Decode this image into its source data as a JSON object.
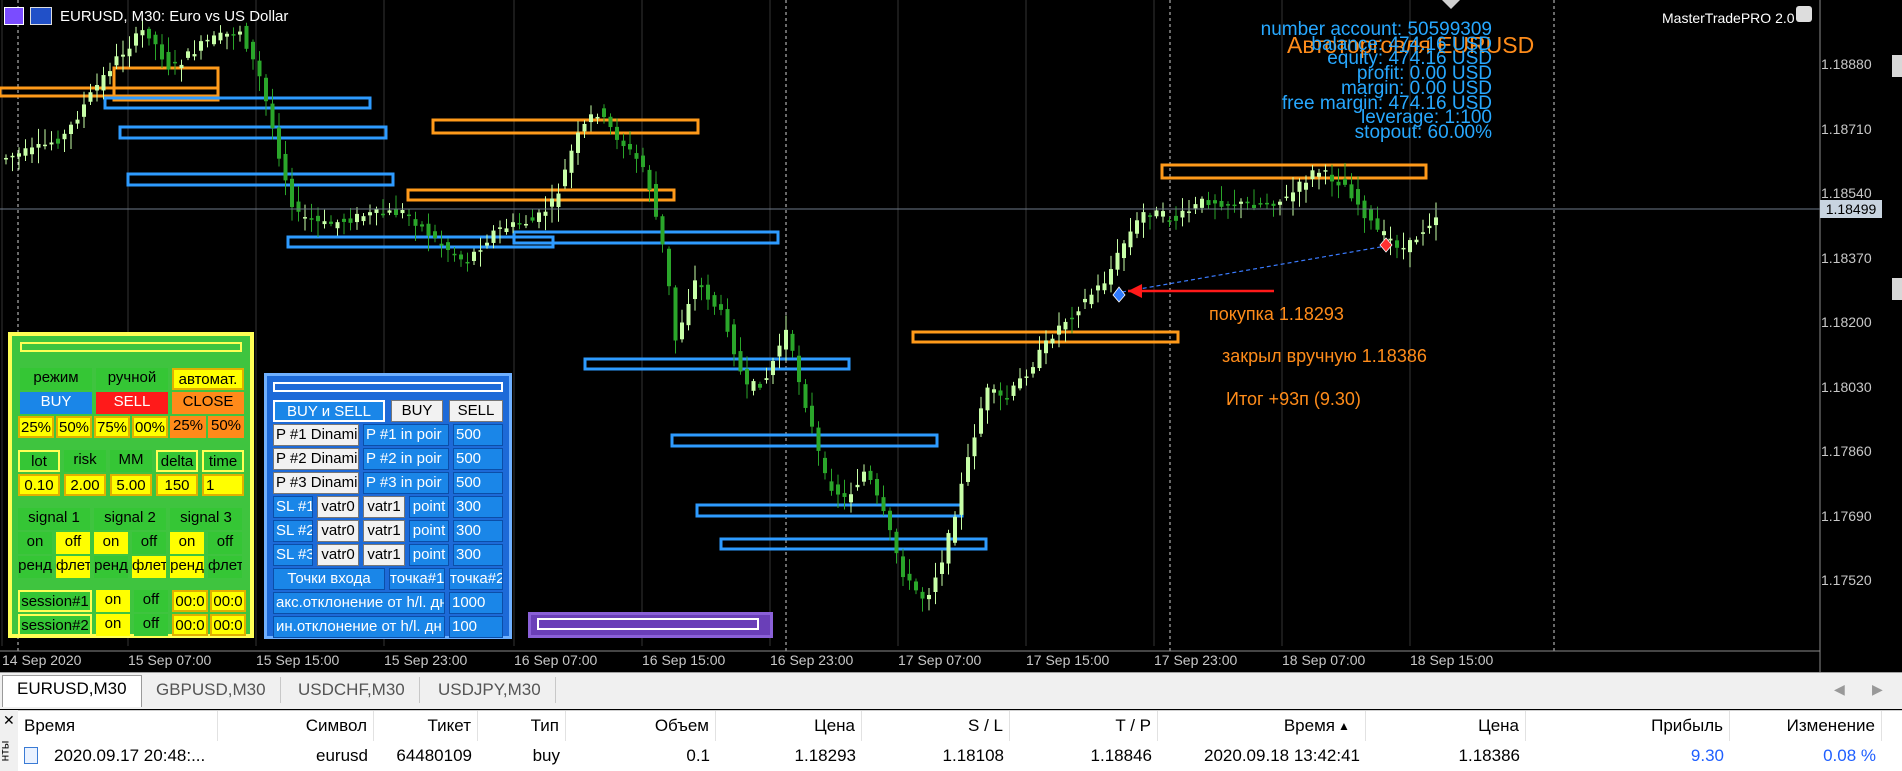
{
  "window": {
    "title": "EURUSD, M30:  Euro vs US Dollar",
    "badge": "MasterTradePRO 2.0"
  },
  "chart_title": "Автоторговля EURUSD",
  "account": [
    "number account: 50599309",
    "balance: 474.16 USD",
    "equity: 474.16 USD",
    "profit: 0.00 USD",
    "margin: 0.00 USD",
    "free margin: 474.16 USD",
    "leverage: 1:100",
    "stopout: 60.00%"
  ],
  "price_axis": [
    "1.18880",
    "1.18710",
    "1.18540",
    "1.18370",
    "1.18200",
    "1.18030",
    "1.17860",
    "1.17690",
    "1.17520"
  ],
  "current_price": "1.18499",
  "time_axis": [
    "14 Sep 2020",
    "15 Sep 07:00",
    "15 Sep 15:00",
    "15 Sep 23:00",
    "16 Sep 07:00",
    "16 Sep 15:00",
    "16 Sep 23:00",
    "17 Sep 07:00",
    "17 Sep 15:00",
    "17 Sep 23:00",
    "18 Sep 07:00",
    "18 Sep 15:00"
  ],
  "annotations": {
    "buy": "покупка 1.18293",
    "closed": "закрыл вручную 1.18386",
    "result": "Итог +93п (9.30)"
  },
  "panel_green": {
    "row1": [
      "режим",
      "ручной",
      "автомат."
    ],
    "row2": [
      "BUY",
      "SELL",
      "CLOSE"
    ],
    "row3": [
      "25%",
      "50%",
      "75%",
      "00%",
      "25%",
      "50%"
    ],
    "row4": [
      "lot",
      "risk",
      "MM",
      "delta",
      "time"
    ],
    "row5": [
      "0.10",
      "2.00",
      "5.00",
      "150",
      "1"
    ],
    "row6": [
      "signal 1",
      "signal 2",
      "signal 3"
    ],
    "row7": [
      "on",
      "off",
      "on",
      "off",
      "on",
      "off"
    ],
    "row8": [
      "ренд",
      "флет",
      "ренд",
      "флет",
      "ренд",
      "флет"
    ],
    "row9": [
      "session#1",
      "on",
      "off",
      "00:0",
      "00:0"
    ],
    "row10": [
      "session#2",
      "on",
      "off",
      "00:0",
      "00:0"
    ]
  },
  "panel_blue": {
    "row1": [
      "BUY и SELL",
      "BUY",
      "SELL"
    ],
    "tp": [
      [
        "P #1 Dinami",
        "P #1 in poir",
        "500"
      ],
      [
        "P #2 Dinami",
        "P #2 in poir",
        "500"
      ],
      [
        "P #3 Dinami",
        "P #3 in poir",
        "500"
      ]
    ],
    "sl": [
      [
        "SL #1",
        "vatr0",
        "vatr1",
        "point",
        "300"
      ],
      [
        "SL #2",
        "vatr0",
        "vatr1",
        "point",
        "300"
      ],
      [
        "SL #3",
        "vatr0",
        "vatr1",
        "point",
        "300"
      ]
    ],
    "entry": [
      "Точки входа",
      "точка#1",
      "точка#2"
    ],
    "maxdev": [
      "акс.отклонение от h/l. дн",
      "1000"
    ],
    "mindev": [
      "ин.отклонение от h/l. дн",
      "100"
    ]
  },
  "tabs": [
    "EURUSD,M30",
    "GBPUSD,M30",
    "USDCHF,M30",
    "USDJPY,M30"
  ],
  "trade_table": {
    "side_label": "нты",
    "headers": [
      "Время",
      "Символ",
      "Тикет",
      "Тип",
      "Объем",
      "Цена",
      "S / L",
      "T / P",
      "Время",
      "Цена",
      "Прибыль",
      "Изменение"
    ],
    "row": [
      "2020.09.17 20:48:...",
      "eurusd",
      "64480109",
      "buy",
      "0.1",
      "1.18293",
      "1.18108",
      "1.18846",
      "2020.09.18 13:42:41",
      "1.18386",
      "9.30",
      "0.08 %"
    ]
  },
  "colors": {
    "orange_zone": "#ff9a1a",
    "blue_zone": "#2e9bff",
    "bull": "#c8ffa8",
    "bear": "#2aa62a",
    "profit": "#1f5fff"
  }
}
